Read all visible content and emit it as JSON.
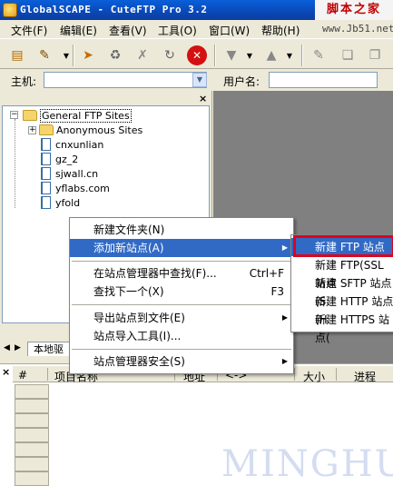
{
  "window": {
    "title": "GlobalSCAPE - CuteFTP Pro 3.2",
    "watermark": "脚本之家",
    "watermark_url": "www.Jb51.net"
  },
  "menubar": {
    "items": [
      "文件(F)",
      "编辑(E)",
      "查看(V)",
      "工具(O)",
      "窗口(W)",
      "帮助(H)"
    ]
  },
  "toolbar": {
    "icons": [
      "open-book-icon",
      "new-site-icon",
      "dropdown-icon",
      "connect-icon",
      "reconnect-icon",
      "disconnect-icon",
      "refresh-icon",
      "stop-icon",
      "download-icon",
      "upload-icon",
      "edit-icon",
      "copy-icon"
    ]
  },
  "hostbar": {
    "host_label": "主机:",
    "host_value": "",
    "user_label": "用户名:",
    "user_value": ""
  },
  "site_tree": {
    "root": "General FTP Sites",
    "items": [
      "Anonymous Sites",
      "cnxunlian",
      "gz_2",
      "sjwall.cn",
      "yflabs.com",
      "yfold"
    ]
  },
  "tabs": {
    "local": "本地驱"
  },
  "context_menu": {
    "items": [
      {
        "label": "新建文件夹(N)",
        "shortcut": ""
      },
      {
        "label": "添加新站点(A)",
        "shortcut": ""
      },
      {
        "label": "在站点管理器中查找(F)...",
        "shortcut": "Ctrl+F"
      },
      {
        "label": "查找下一个(X)",
        "shortcut": "F3"
      },
      {
        "label": "导出站点到文件(E)",
        "shortcut": ""
      },
      {
        "label": "站点导入工具(I)...",
        "shortcut": ""
      },
      {
        "label": "站点管理器安全(S)",
        "shortcut": ""
      }
    ]
  },
  "submenu": {
    "items": [
      "新建 FTP 站点(F)",
      "新建 FTP(SSL 站点",
      "新建 SFTP 站点(S",
      "新建 HTTP 站点(H",
      "新建 HTTPS 站点("
    ]
  },
  "queue": {
    "columns": [
      "#",
      "项目名称",
      "地址",
      "<->",
      "大小",
      "进程"
    ]
  },
  "footer_watermark": "MINGHU"
}
